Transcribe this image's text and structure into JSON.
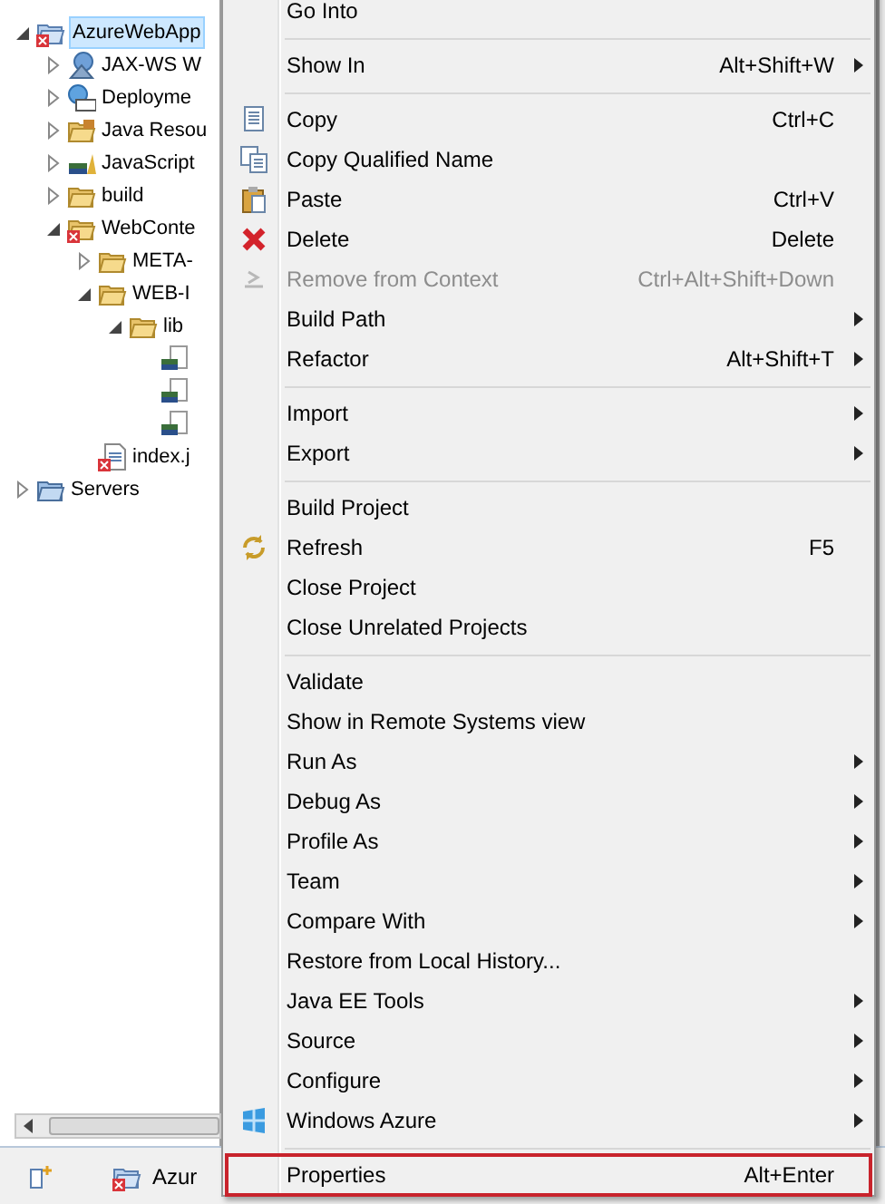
{
  "project_explorer": {
    "tree": [
      {
        "label": "AzureWebApp",
        "kind": "project",
        "selected": true,
        "expanded": true,
        "children": [
          {
            "label": "JAX-WS W",
            "kind": "webservice",
            "selected": false,
            "expanded": false
          },
          {
            "label": "Deployme",
            "kind": "deployment",
            "selected": false,
            "expanded": false
          },
          {
            "label": "Java Resou",
            "kind": "java-resources",
            "selected": false,
            "expanded": false
          },
          {
            "label": "JavaScript",
            "kind": "javascript",
            "selected": false,
            "expanded": false
          },
          {
            "label": "build",
            "kind": "folder",
            "selected": false,
            "expanded": false
          },
          {
            "label": "WebConte",
            "kind": "error-folder",
            "selected": false,
            "expanded": true,
            "children": [
              {
                "label": "META-",
                "kind": "folder",
                "selected": false,
                "expanded": false
              },
              {
                "label": "WEB-I",
                "kind": "folder",
                "selected": false,
                "expanded": true,
                "children": [
                  {
                    "label": "lib",
                    "kind": "folder",
                    "selected": false,
                    "expanded": true,
                    "children": [
                      {
                        "kind": "jar"
                      },
                      {
                        "kind": "jar"
                      },
                      {
                        "kind": "jar"
                      }
                    ]
                  }
                ]
              },
              {
                "label": "index.j",
                "kind": "jsp",
                "selected": false
              }
            ]
          }
        ]
      },
      {
        "label": "Servers",
        "kind": "servers",
        "selected": false,
        "expanded": false
      }
    ]
  },
  "bottom_bar": {
    "tab": "Azur"
  },
  "context_menu": {
    "groups": [
      [
        {
          "label": "Go Into",
          "submenu": false,
          "disabled": false,
          "highlighted": false
        }
      ],
      [
        {
          "label": "Show In",
          "shortcut": "Alt+Shift+W",
          "submenu": true,
          "disabled": false,
          "highlighted": false
        }
      ],
      [
        {
          "label": "Copy",
          "shortcut": "Ctrl+C",
          "submenu": false,
          "disabled": false,
          "highlighted": false,
          "kind": "copy"
        },
        {
          "label": "Copy Qualified Name",
          "submenu": false,
          "disabled": false,
          "highlighted": false,
          "kind": "copy-name"
        },
        {
          "label": "Paste",
          "shortcut": "Ctrl+V",
          "submenu": false,
          "disabled": false,
          "highlighted": false,
          "kind": "paste"
        },
        {
          "label": "Delete",
          "shortcut": "Delete",
          "submenu": false,
          "disabled": false,
          "highlighted": false,
          "kind": "delete"
        },
        {
          "label": "Remove from Context",
          "shortcut": "Ctrl+Alt+Shift+Down",
          "submenu": false,
          "disabled": true,
          "highlighted": false,
          "kind": "remove"
        },
        {
          "label": "Build Path",
          "submenu": true,
          "disabled": false,
          "highlighted": false
        },
        {
          "label": "Refactor",
          "shortcut": "Alt+Shift+T",
          "submenu": true,
          "disabled": false,
          "highlighted": false
        }
      ],
      [
        {
          "label": "Import",
          "submenu": true,
          "disabled": false,
          "highlighted": false
        },
        {
          "label": "Export",
          "submenu": true,
          "disabled": false,
          "highlighted": false
        }
      ],
      [
        {
          "label": "Build Project",
          "submenu": false,
          "disabled": false,
          "highlighted": false
        },
        {
          "label": "Refresh",
          "shortcut": "F5",
          "submenu": false,
          "disabled": false,
          "highlighted": false,
          "kind": "refresh"
        },
        {
          "label": "Close Project",
          "submenu": false,
          "disabled": false,
          "highlighted": false
        },
        {
          "label": "Close Unrelated Projects",
          "submenu": false,
          "disabled": false,
          "highlighted": false
        }
      ],
      [
        {
          "label": "Validate",
          "submenu": false,
          "disabled": false,
          "highlighted": false
        },
        {
          "label": "Show in Remote Systems view",
          "submenu": false,
          "disabled": false,
          "highlighted": false
        },
        {
          "label": "Run As",
          "submenu": true,
          "disabled": false,
          "highlighted": false
        },
        {
          "label": "Debug As",
          "submenu": true,
          "disabled": false,
          "highlighted": false
        },
        {
          "label": "Profile As",
          "submenu": true,
          "disabled": false,
          "highlighted": false
        },
        {
          "label": "Team",
          "submenu": true,
          "disabled": false,
          "highlighted": false
        },
        {
          "label": "Compare With",
          "submenu": true,
          "disabled": false,
          "highlighted": false
        },
        {
          "label": "Restore from Local History...",
          "submenu": false,
          "disabled": false,
          "highlighted": false
        },
        {
          "label": "Java EE Tools",
          "submenu": true,
          "disabled": false,
          "highlighted": false
        },
        {
          "label": "Source",
          "submenu": true,
          "disabled": false,
          "highlighted": false
        },
        {
          "label": "Configure",
          "submenu": true,
          "disabled": false,
          "highlighted": false
        },
        {
          "label": "Windows Azure",
          "submenu": true,
          "disabled": false,
          "highlighted": false,
          "kind": "azure"
        }
      ],
      [
        {
          "label": "Properties",
          "shortcut": "Alt+Enter",
          "submenu": false,
          "disabled": false,
          "highlighted": true
        }
      ]
    ]
  }
}
